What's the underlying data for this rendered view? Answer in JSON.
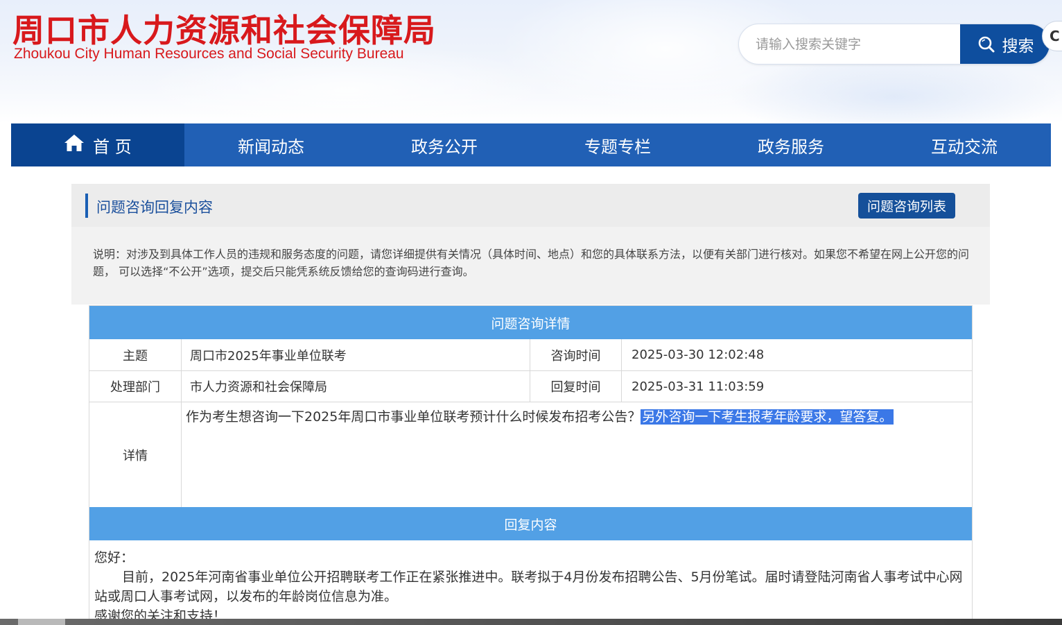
{
  "header": {
    "title_cn": "周口市人力资源和社会保障局",
    "title_en": "Zhoukou City Human Resources and Social Security Bureau",
    "title_color": "#d8191c",
    "search": {
      "placeholder": "请输入搜索关键字",
      "value": "",
      "button_label": "搜索",
      "button_icon": "search-icon",
      "button_color": "#0e4e9e"
    },
    "corner_button_label": "C"
  },
  "nav": {
    "color": "#2160b5",
    "active_color": "#0a4491",
    "items": [
      {
        "label": "首 页",
        "icon": "home-icon"
      },
      {
        "label": "新闻动态"
      },
      {
        "label": "政务公开"
      },
      {
        "label": "专题专栏"
      },
      {
        "label": "政务服务"
      },
      {
        "label": "互动交流"
      }
    ]
  },
  "panel": {
    "title": "问题咨询回复内容",
    "list_button": "问题咨询列表",
    "note": "说明：对涉及到具体工作人员的违规和服务态度的问题，请您详细提供有关情况（具体时间、地点）和您的具体联系方法，以便有关部门进行核对。如果您不希望在网上公开您的问题， 可以选择“不公开”选项，提交后只能凭系统反馈给您的查询码进行查询。"
  },
  "details": {
    "header": "问题咨询详情",
    "header_color": "#52a0e5",
    "rows": [
      {
        "label": "主题",
        "value": "周口市2025年事业单位联考",
        "label2": "咨询时间",
        "value2": "2025-03-30 12:02:48"
      },
      {
        "label": "处理部门",
        "value": "市人力资源和社会保障局",
        "label2": "回复时间",
        "value2": "2025-03-31 11:03:59"
      }
    ],
    "detail_label": "详情",
    "detail_text": "作为考生想咨询一下2025年周口市事业单位联考预计什么时候发布招考公告？",
    "detail_text_highlighted": "另外咨询一下考生报考年龄要求，望答复。",
    "reply_header": "回复内容",
    "reply": {
      "greeting": "您好：",
      "body": "目前，2025年河南省事业单位公开招聘联考工作正在紧张推进中。联考拟于4月份发布招聘公告、5月份笔试。届时请登陆河南省人事考试中心网站或周口人事考试网，以发布的年龄岗位信息为准。",
      "closing": "感谢您的关注和支持！"
    }
  }
}
